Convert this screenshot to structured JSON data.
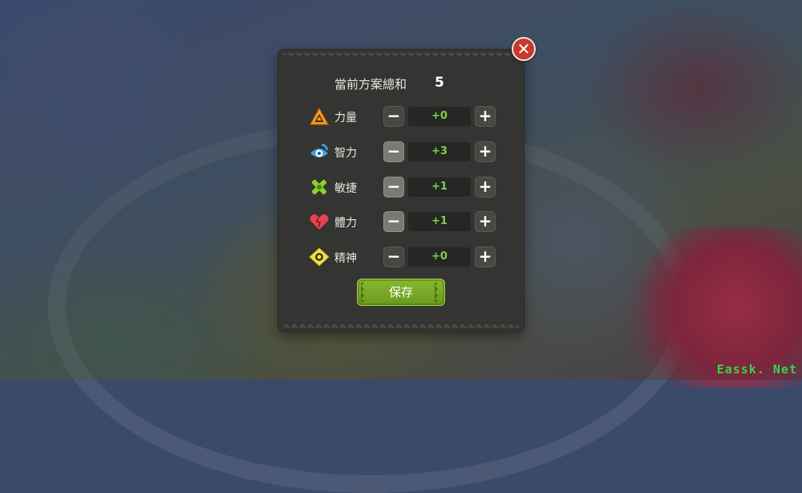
{
  "dialog": {
    "total_label": "當前方案總和",
    "total_value": "5",
    "close_icon": "close-icon",
    "save_label": "保存"
  },
  "stats": [
    {
      "icon": "strength-triangle-icon",
      "label": "力量",
      "value": "+0",
      "minus_active": false
    },
    {
      "icon": "intellect-eye-icon",
      "label": "智力",
      "value": "+3",
      "minus_active": true
    },
    {
      "icon": "agility-cross-icon",
      "label": "敏捷",
      "value": "+1",
      "minus_active": true
    },
    {
      "icon": "vitality-heart-icon",
      "label": "體力",
      "value": "+1",
      "minus_active": true
    },
    {
      "icon": "spirit-diamond-icon",
      "label": "精神",
      "value": "+0",
      "minus_active": false
    }
  ],
  "controls": {
    "minus_symbol": "−",
    "plus_symbol": "+"
  },
  "colors": {
    "panel": "#343432",
    "value_green": "#7fd14a",
    "save_green": "#7aaa25",
    "close_red": "#c7392f"
  },
  "watermark": "Eassk. Net"
}
